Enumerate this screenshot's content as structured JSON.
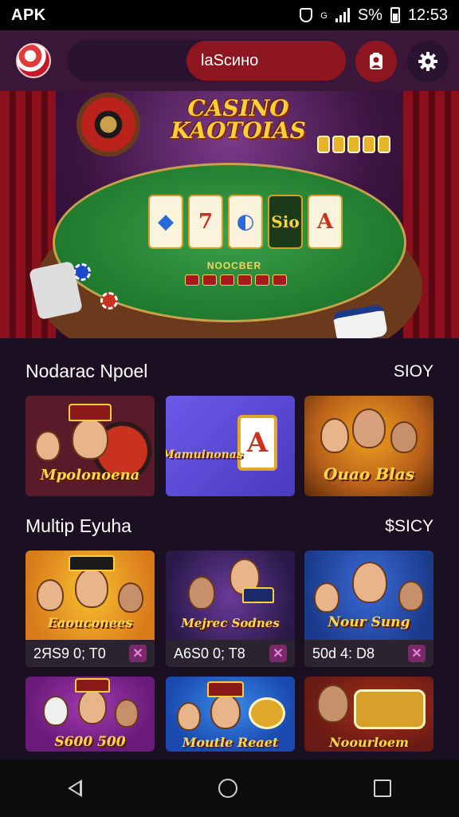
{
  "status_bar": {
    "left_label": "APK",
    "battery_text": "S%",
    "network_label": "G",
    "time": "12:53"
  },
  "header": {
    "search_value": "lаSсинo",
    "icons": [
      "lantern-logo-icon",
      "profile-icon",
      "gear-icon"
    ]
  },
  "hero": {
    "title_line1": "CASINO",
    "title_line2": "KAOTOIAS",
    "reels": [
      "",
      "7",
      "",
      "Sio",
      "A"
    ],
    "felt_label": "NOOCBER"
  },
  "sections": [
    {
      "title": "Nodarac Npoel",
      "more_label": "SIOY",
      "tiles": [
        {
          "caption": "Mpolonoena",
          "bg": "#5a1a2a"
        },
        {
          "caption": "Mamuinonas",
          "bg": "#5b4bd6"
        },
        {
          "caption": "Ouao Blas",
          "bg": "#b8601a"
        }
      ]
    },
    {
      "title": "Multip Eyuha",
      "more_label": "$SICY",
      "tiles": [
        {
          "caption": "Eaouconees",
          "footer": "2ЯS9 0; T0",
          "bg": "#d87a1a"
        },
        {
          "caption": "Mejrec Sodnes",
          "footer": "A6S0 0; T8",
          "bg": "#2a1a4a"
        },
        {
          "caption": "Nour Sung",
          "footer": "50d 4: D8",
          "bg": "#1a3a8a"
        }
      ]
    },
    {
      "tiles": [
        {
          "caption": "S600 500",
          "bg": "#6a1a7a"
        },
        {
          "caption": "Moutle Reaet",
          "bg": "#1a4ab0"
        },
        {
          "caption": "Noourloem",
          "bg": "#6a1a14"
        }
      ]
    }
  ],
  "nav": {
    "icons": [
      "back-icon",
      "home-icon",
      "recents-icon"
    ]
  },
  "colors": {
    "header_bg": "#3a1638",
    "accent_red": "#8e1620",
    "page_bg": "#1b0f22"
  }
}
